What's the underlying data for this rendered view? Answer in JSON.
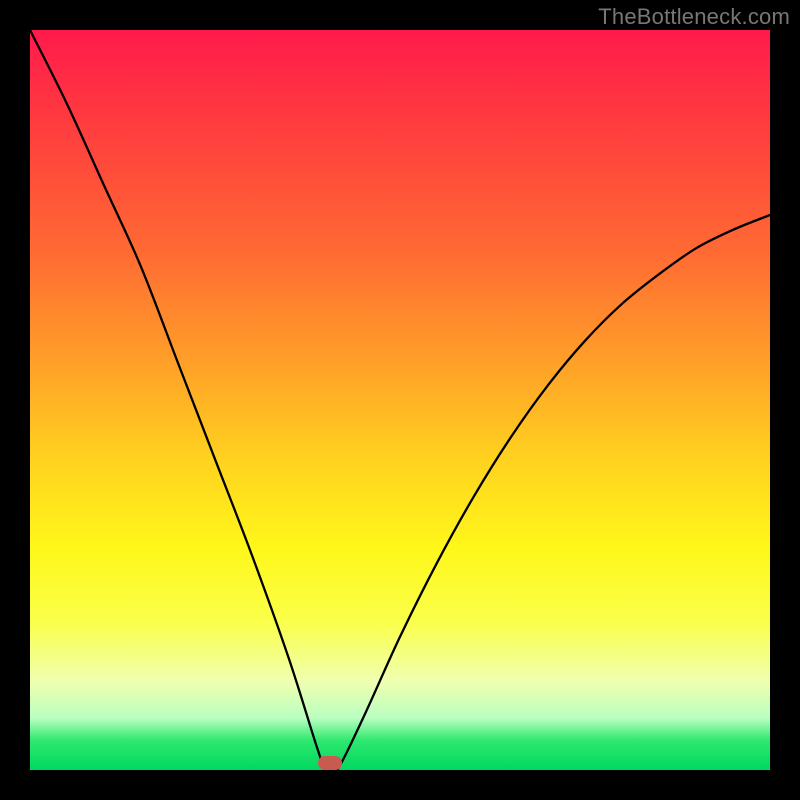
{
  "watermark": "TheBottleneck.com",
  "colors": {
    "bg": "#000000",
    "grad_top": "#ff1a4c",
    "grad_bottom": "#00d860",
    "curve": "#000000",
    "marker": "#c95a50"
  },
  "chart_data": {
    "type": "line",
    "title": "",
    "xlabel": "",
    "ylabel": "",
    "xlim": [
      0,
      100
    ],
    "ylim": [
      0,
      100
    ],
    "x": [
      0,
      5,
      10,
      15,
      20,
      25,
      30,
      35,
      38.8,
      40,
      41.5,
      45,
      50,
      55,
      60,
      65,
      70,
      75,
      80,
      85,
      90,
      95,
      100
    ],
    "values": [
      100,
      90,
      79,
      68,
      55,
      42,
      29,
      15,
      3,
      0,
      0,
      7,
      18,
      28,
      37,
      45,
      52,
      58,
      63,
      67,
      70.5,
      73,
      75
    ],
    "minimum_x": 40,
    "minimum_y": 0,
    "marker": {
      "x": 40.5,
      "y": 0.5
    }
  }
}
